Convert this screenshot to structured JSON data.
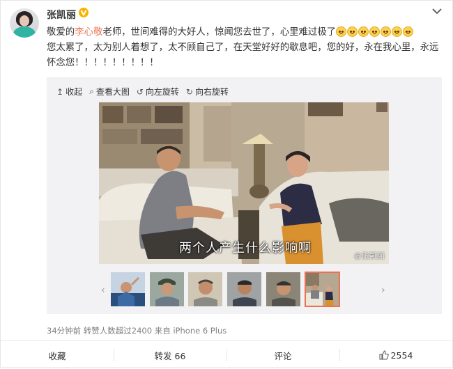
{
  "post": {
    "author": "张凯丽",
    "text_before_mention": "敬爱的",
    "mention": "李心敬",
    "text_after_mention": "老师，世间难得的大好人，惊闻您去世了，心里难过极了",
    "text_after_emoji": "您太累了，太为别人着想了，太不顾自己了，在天堂好好的歇息吧，您的好，永在我心里，永远怀念您！！！！！！！！！",
    "emoji_count": 7,
    "emoji_name": "crying-face-icon"
  },
  "media": {
    "toolbar": [
      {
        "icon": "↥",
        "label": "收起"
      },
      {
        "icon": "⌕",
        "label": "查看大图"
      },
      {
        "icon": "↺",
        "label": "向左旋转"
      },
      {
        "icon": "↻",
        "label": "向右旋转"
      }
    ],
    "caption": "两个人产生什么影响啊",
    "watermark": "@张凯丽",
    "selected_thumbnail": 6,
    "thumbnail_count": 6
  },
  "meta": "34分钟前 转赞人数超过2400 来自 iPhone 6 Plus",
  "actions": {
    "favorite": "收藏",
    "repost": "转发 66",
    "comment": "评论",
    "like": "2554"
  },
  "colors": {
    "mention": "#eb7350",
    "verified_badge": "#f7b500",
    "selected_outline": "#eb7350"
  }
}
